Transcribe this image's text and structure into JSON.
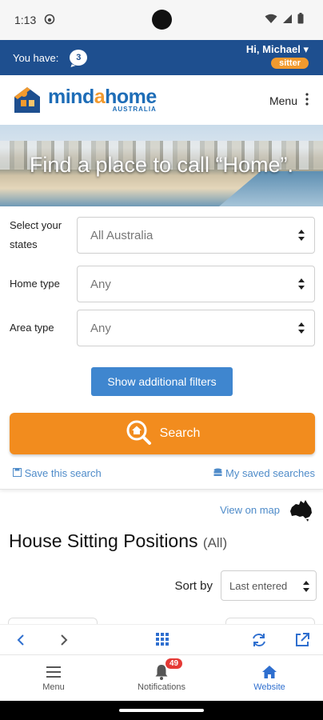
{
  "status_bar": {
    "time": "1:13"
  },
  "user_bar": {
    "you_have_label": "You have:",
    "message_count": "3",
    "greeting": "Hi, Michael",
    "role_badge": "sitter"
  },
  "header": {
    "logo_part1": "mind",
    "logo_part2": "a",
    "logo_part3": "home",
    "logo_sub": "AUSTRALIA",
    "menu_label": "Menu"
  },
  "hero": {
    "tagline": "Find a place to call “Home”."
  },
  "search_form": {
    "states_label": "Select your states",
    "states_value": "All Australia",
    "home_type_label": "Home type",
    "home_type_value": "Any",
    "area_type_label": "Area type",
    "area_type_value": "Any",
    "filters_button": "Show additional filters",
    "search_button": "Search",
    "save_search_link": "Save this search",
    "saved_searches_link": "My saved searches"
  },
  "map": {
    "view_on_map": "View on map"
  },
  "listing": {
    "title": "House Sitting Positions",
    "filter_tag": "(All)",
    "sort_label": "Sort by",
    "sort_value": "Last entered"
  },
  "bottom_nav": {
    "menu_label": "Menu",
    "notifications_label": "Notifications",
    "notifications_count": "49",
    "website_label": "Website"
  },
  "colors": {
    "brand_blue": "#1e4f8f",
    "accent_orange": "#f28c1e",
    "link_blue": "#4e8bc9",
    "nav_active": "#2f6fcf"
  }
}
